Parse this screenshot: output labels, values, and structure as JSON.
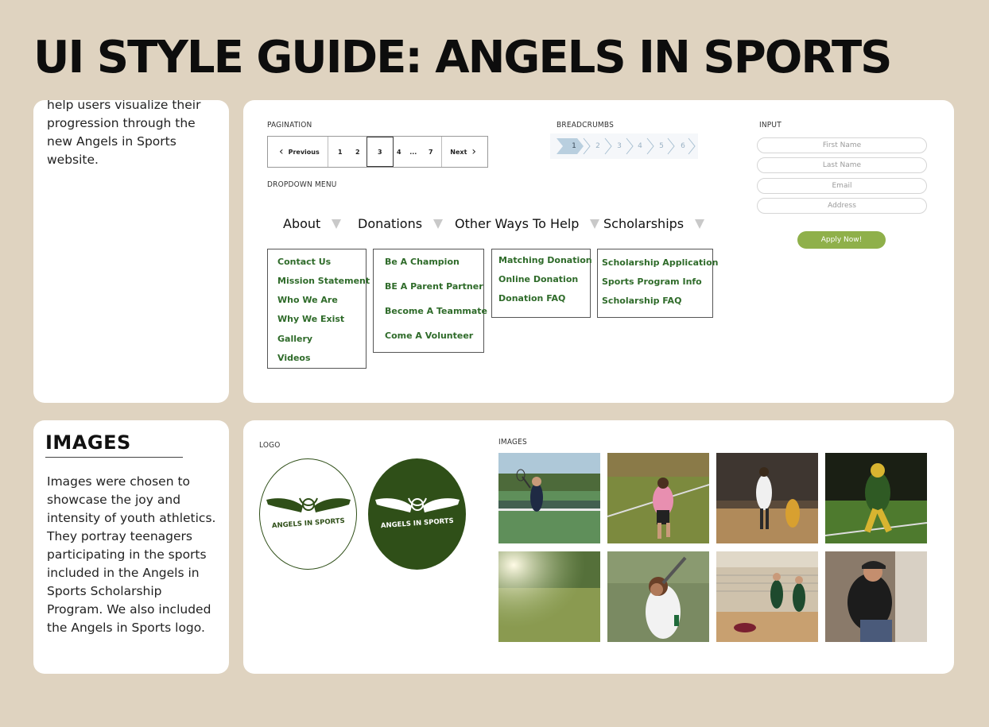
{
  "page_title": "UI STYLE GUIDE: ANGELS IN SPORTS",
  "intro": {
    "partial_line": "help users visualize their",
    "lines": [
      "progression through the",
      "new Angels in Sports",
      "website."
    ]
  },
  "pagination": {
    "label": "PAGINATION",
    "prev": "Previous",
    "next": "Next",
    "pages": [
      "1",
      "2",
      "3",
      "4",
      "...",
      "7"
    ],
    "active_page": "3"
  },
  "breadcrumbs": {
    "label": "BREADCRUMBS",
    "steps": [
      "1",
      "2",
      "3",
      "4",
      "5",
      "6"
    ],
    "active_step": "1"
  },
  "input": {
    "label": "INPUT",
    "fields": [
      "First Name",
      "Last Name",
      "Email",
      "Address"
    ],
    "button": "Apply Now!"
  },
  "dropdown": {
    "label": "DROPDOWN MENU",
    "menus": [
      {
        "title": "About",
        "items": [
          "Contact Us",
          "Mission Statement",
          "Who We Are",
          "Why We Exist",
          "Gallery",
          "Videos"
        ]
      },
      {
        "title": "Donations",
        "items": [
          "Be A Champion",
          "BE A Parent Partner",
          "Become A Teammate",
          "Come A Volunteer"
        ]
      },
      {
        "title": "Other Ways To Help",
        "items": [
          "Matching Donation",
          "Online Donation",
          "Donation FAQ"
        ]
      },
      {
        "title": "Scholarships",
        "items": [
          "Scholarship Application",
          "Sports Program Info",
          "Scholarship FAQ"
        ]
      }
    ]
  },
  "images_section": {
    "heading": "IMAGES",
    "description_lines": [
      "Images were chosen to",
      "showcase the joy and",
      "intensity of youth athletics.",
      "They portray teenagers",
      "participating in the sports",
      "included in the  Angels in",
      "Sports Scholarship",
      "Program. We also included",
      "the Angels in Sports logo."
    ],
    "logo_label": "LOGO",
    "logo_text": "ANGELS IN SPORTS",
    "images_label": "IMAGES"
  },
  "colors": {
    "background": "#dfd3c0",
    "brand_green": "#2f4f18",
    "link_green": "#2f6b2a",
    "button_green": "#8fb04a",
    "breadcrumb_active": "#b9cfdf"
  }
}
